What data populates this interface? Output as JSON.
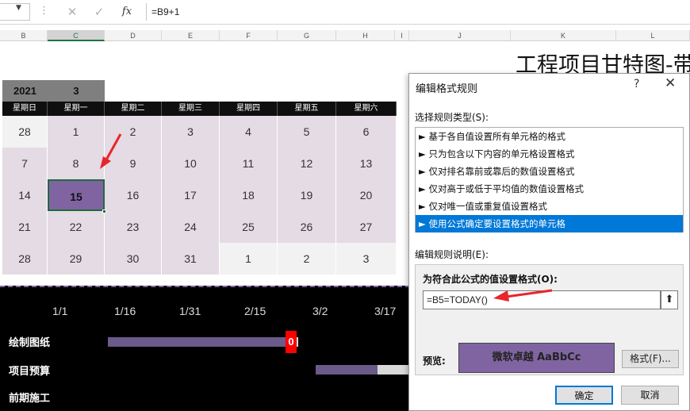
{
  "formula_bar": {
    "namebox_arrow": "▼",
    "dots": "⋮",
    "cancel_glyph": "✕",
    "enter_glyph": "✓",
    "fx_glyph": "fx",
    "formula": "=B9+1"
  },
  "columns": [
    "B",
    "C",
    "D",
    "E",
    "F",
    "G",
    "H",
    "I",
    "J",
    "K",
    "L"
  ],
  "sheet_title": "工程项目甘特图-带",
  "calendar": {
    "year": "2021",
    "month": "3",
    "weekdays": [
      "星期日",
      "星期一",
      "星期二",
      "星期三",
      "星期四",
      "星期五",
      "星期六"
    ],
    "weeks": [
      [
        "28",
        "1",
        "2",
        "3",
        "4",
        "5",
        "6"
      ],
      [
        "7",
        "8",
        "9",
        "10",
        "11",
        "12",
        "13"
      ],
      [
        "14",
        "15",
        "16",
        "17",
        "18",
        "19",
        "20"
      ],
      [
        "21",
        "22",
        "23",
        "24",
        "25",
        "26",
        "27"
      ],
      [
        "28",
        "29",
        "30",
        "31",
        "1",
        "2",
        "3"
      ]
    ]
  },
  "gantt": {
    "dates": [
      "1/1",
      "1/16",
      "1/31",
      "2/15",
      "3/2",
      "3/17"
    ],
    "tasks": [
      "绘制图纸",
      "项目预算",
      "前期施工"
    ],
    "zero_label": "0"
  },
  "dialog": {
    "title": "编辑格式规则",
    "help": "?",
    "close": "✕",
    "rule_type_label": "选择规则类型(S):",
    "rule_types": [
      "► 基于各自值设置所有单元格的格式",
      "► 只为包含以下内容的单元格设置格式",
      "► 仅对排名靠前或靠后的数值设置格式",
      "► 仅对高于或低于平均值的数值设置格式",
      "► 仅对唯一值或重复值设置格式",
      "► 使用公式确定要设置格式的单元格"
    ],
    "desc_label": "编辑规则说明(E):",
    "formula_label": "为符合此公式的值设置格式(O):",
    "formula_value": "=B5=TODAY()",
    "collapse_glyph": "⬆",
    "preview_label": "预览:",
    "preview_text": "微软卓越  AaBbCc",
    "format_button": "格式(F)...",
    "ok": "确定",
    "cancel": "取消"
  },
  "colors": {
    "accent": "#8064a2",
    "light_purple": "#e4dbe4",
    "selected": "#0078d7",
    "red": "#ff0000"
  }
}
